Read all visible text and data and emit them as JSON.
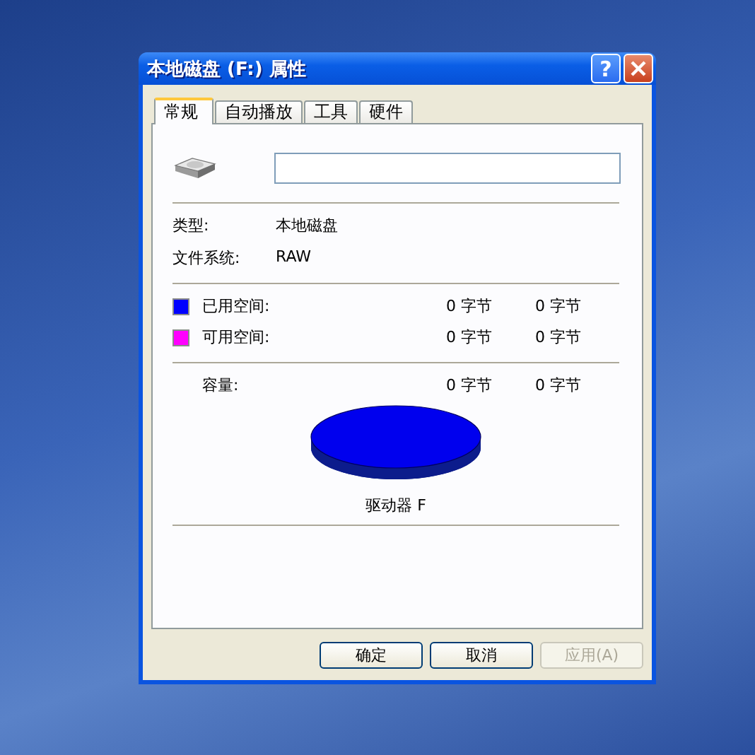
{
  "window": {
    "title": "本地磁盘 (F:) 属性",
    "help_button": "?"
  },
  "tabs": [
    {
      "label": "常规",
      "selected": true
    },
    {
      "label": "自动播放",
      "selected": false
    },
    {
      "label": "工具",
      "selected": false
    },
    {
      "label": "硬件",
      "selected": false
    }
  ],
  "info": [
    {
      "label": "类型:",
      "value": "本地磁盘"
    },
    {
      "label": "文件系统:",
      "value": "RAW"
    }
  ],
  "space": [
    {
      "label": "已用空间:",
      "color": "#0000ff",
      "bytes": "0 字节",
      "size": "0 字节"
    },
    {
      "label": "可用空间:",
      "color": "#ff00ff",
      "bytes": "0 字节",
      "size": "0 字节"
    }
  ],
  "capacity": {
    "label": "容量:",
    "bytes": "0 字节",
    "size": "0 字节"
  },
  "drive_label": "驱动器 F",
  "buttons": [
    {
      "label": "确定",
      "disabled": false
    },
    {
      "label": "取消",
      "disabled": false
    },
    {
      "label": "应用(A)",
      "disabled": true
    }
  ]
}
